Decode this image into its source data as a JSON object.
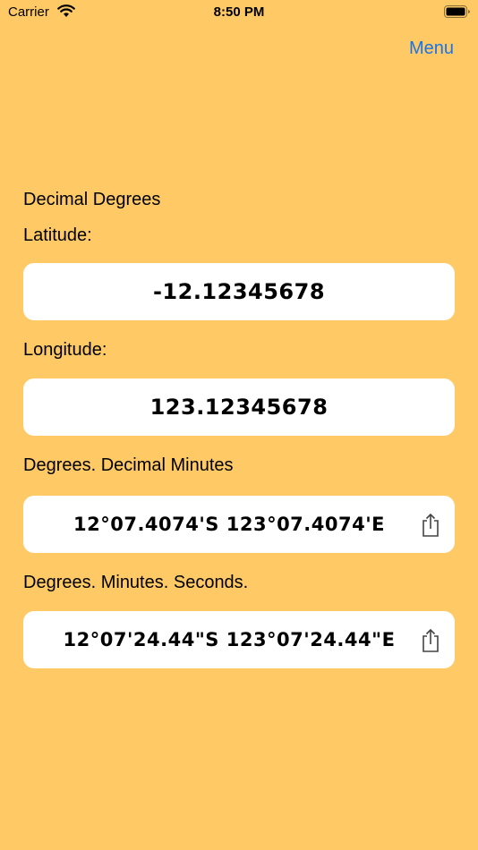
{
  "status_bar": {
    "carrier": "Carrier",
    "time": "8:50 PM"
  },
  "nav": {
    "menu_label": "Menu"
  },
  "decimal": {
    "heading": "Decimal Degrees",
    "latitude_label": "Latitude:",
    "latitude_value": "-12.12345678",
    "longitude_label": "Longitude:",
    "longitude_value": "123.12345678"
  },
  "ddm": {
    "heading": "Degrees. Decimal Minutes",
    "value": "12°07.4074'S 123°07.4074'E",
    "share_icon": "share-icon"
  },
  "dms": {
    "heading": "Degrees. Minutes. Seconds.",
    "value": "12°07'24.44\"S 123°07'24.44\"E",
    "share_icon": "share-icon"
  },
  "colors": {
    "background": "#FFCA66",
    "accent": "#1A73E8",
    "field": "#FFFFFF"
  }
}
